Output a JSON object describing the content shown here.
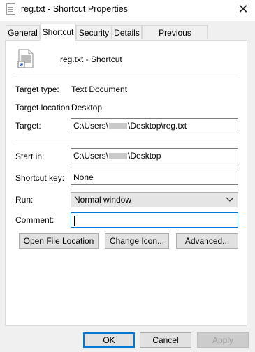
{
  "window": {
    "title": "reg.txt - Shortcut Properties",
    "close_glyph": "✕"
  },
  "tabs": [
    {
      "label": "General"
    },
    {
      "label": "Shortcut"
    },
    {
      "label": "Security"
    },
    {
      "label": "Details"
    },
    {
      "label": "Previous Versions"
    }
  ],
  "header": {
    "name": "reg.txt - Shortcut"
  },
  "fields": {
    "target_type": {
      "label": "Target type:",
      "value": "Text Document"
    },
    "target_location": {
      "label": "Target location:",
      "value": "Desktop"
    },
    "target": {
      "label": "Target:",
      "prefix": "C:\\Users\\",
      "suffix": "\\Desktop\\reg.txt"
    },
    "start_in": {
      "label": "Start in:",
      "prefix": "C:\\Users\\",
      "suffix": "\\Desktop"
    },
    "shortcut_key": {
      "label": "Shortcut key:",
      "value": "None"
    },
    "run": {
      "label": "Run:",
      "value": "Normal window"
    },
    "comment": {
      "label": "Comment:",
      "value": ""
    }
  },
  "buttons": {
    "open_file_location": "Open File Location",
    "change_icon": "Change Icon...",
    "advanced": "Advanced...",
    "ok": "OK",
    "cancel": "Cancel",
    "apply": "Apply"
  },
  "icons": {
    "window": "text-file-icon",
    "file": "text-file-shortcut-icon",
    "close": "close-icon",
    "dropdown": "chevron-down-icon"
  },
  "colors": {
    "focus_accent": "#0078d7"
  }
}
